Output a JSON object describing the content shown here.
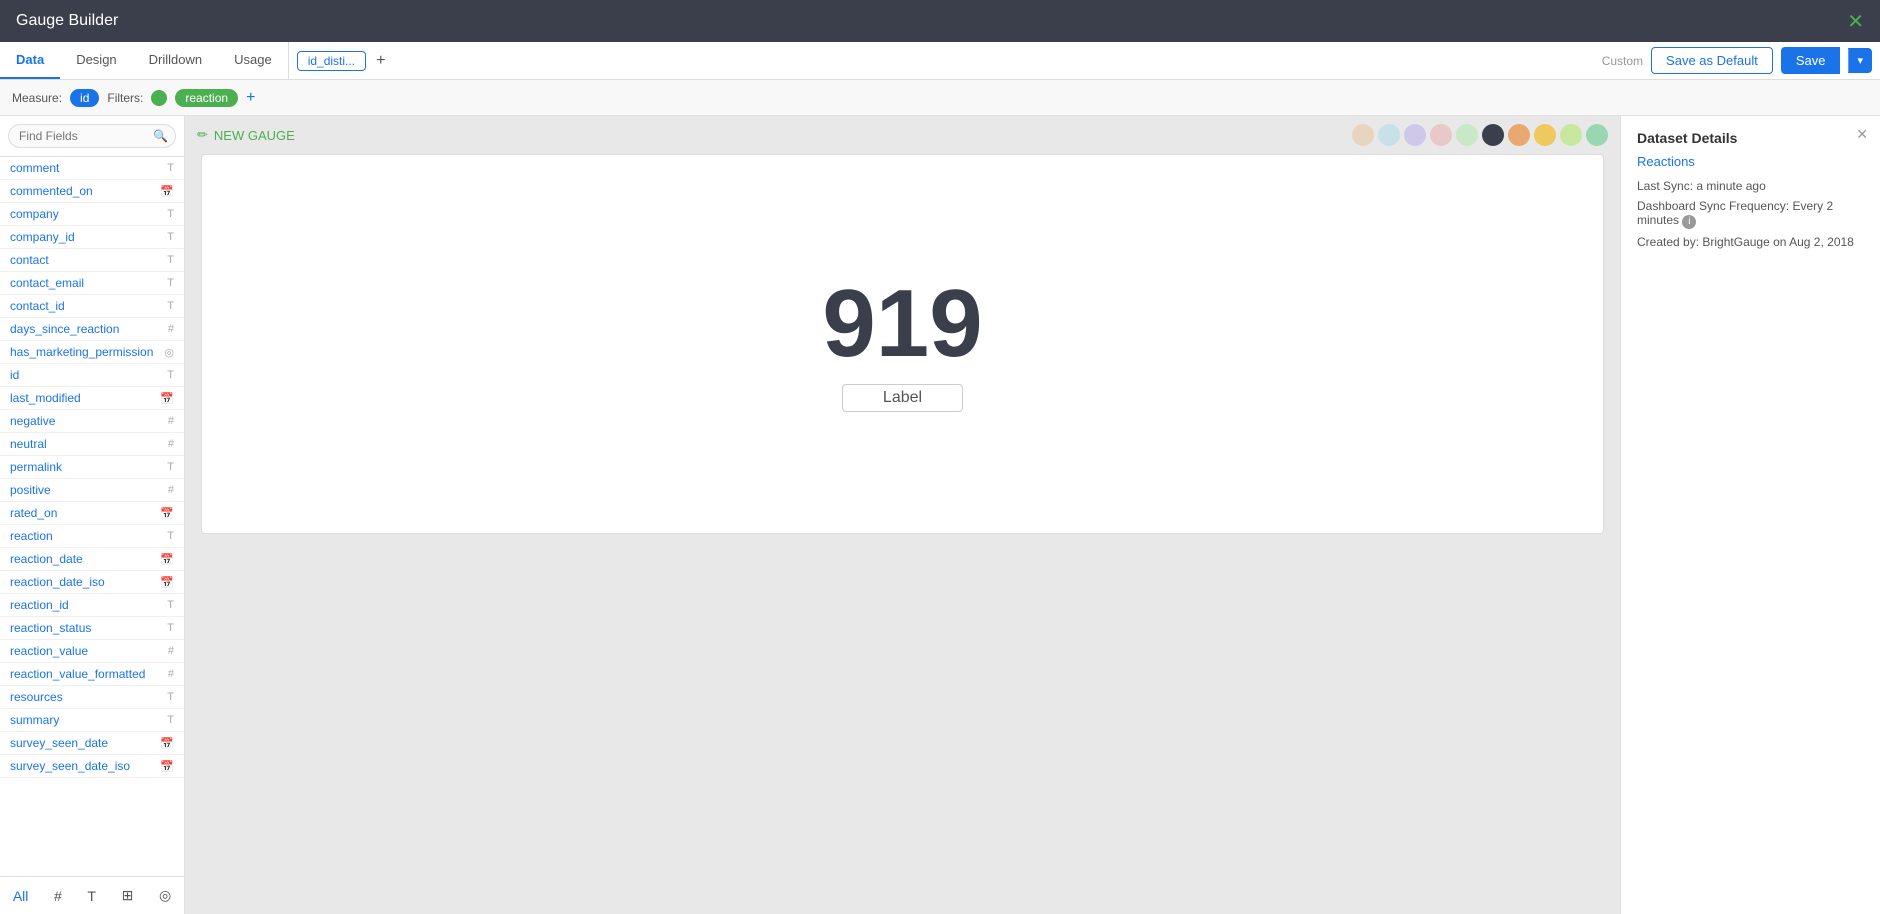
{
  "app": {
    "title": "Gauge Builder",
    "close_icon": "✕"
  },
  "tabs": {
    "items": [
      {
        "id": "data",
        "label": "Data",
        "active": true
      },
      {
        "id": "design",
        "label": "Design",
        "active": false
      },
      {
        "id": "drilldown",
        "label": "Drilldown",
        "active": false
      },
      {
        "id": "usage",
        "label": "Usage",
        "active": false
      }
    ]
  },
  "dataset_tabs": {
    "items": [
      {
        "id": "id_dist",
        "label": "id_disti...",
        "active": true
      }
    ],
    "add_label": "+"
  },
  "toolbar": {
    "custom_label": "Custom",
    "save_default_label": "Save as Default",
    "save_label": "Save",
    "dropdown_icon": "▾"
  },
  "measure_bar": {
    "measure_label": "Measure:",
    "measure_value": "id",
    "filters_label": "Filters:",
    "filter_value": "reaction",
    "add_icon": "+"
  },
  "sidebar": {
    "search_placeholder": "Find Fields",
    "fields": [
      {
        "name": "comment",
        "type": "T"
      },
      {
        "name": "commented_on",
        "type": "cal"
      },
      {
        "name": "company",
        "type": "T"
      },
      {
        "name": "company_id",
        "type": "T"
      },
      {
        "name": "contact",
        "type": "T"
      },
      {
        "name": "contact_email",
        "type": "T"
      },
      {
        "name": "contact_id",
        "type": "T"
      },
      {
        "name": "days_since_reaction",
        "type": "#"
      },
      {
        "name": "has_marketing_permission",
        "type": "eye"
      },
      {
        "name": "id",
        "type": "T"
      },
      {
        "name": "last_modified",
        "type": "cal"
      },
      {
        "name": "negative",
        "type": "#"
      },
      {
        "name": "neutral",
        "type": "#"
      },
      {
        "name": "permalink",
        "type": "T"
      },
      {
        "name": "positive",
        "type": "#"
      },
      {
        "name": "rated_on",
        "type": "cal"
      },
      {
        "name": "reaction",
        "type": "T"
      },
      {
        "name": "reaction_date",
        "type": "cal"
      },
      {
        "name": "reaction_date_iso",
        "type": "cal"
      },
      {
        "name": "reaction_id",
        "type": "T"
      },
      {
        "name": "reaction_status",
        "type": "T"
      },
      {
        "name": "reaction_value",
        "type": "#"
      },
      {
        "name": "reaction_value_formatted",
        "type": "#"
      },
      {
        "name": "resources",
        "type": "T"
      },
      {
        "name": "summary",
        "type": "T"
      },
      {
        "name": "survey_seen_date",
        "type": "cal"
      },
      {
        "name": "survey_seen_date_iso",
        "type": "cal"
      }
    ],
    "footer_filters": [
      {
        "id": "all",
        "label": "All",
        "active": true
      },
      {
        "id": "hash",
        "label": "#"
      },
      {
        "id": "text",
        "label": "T"
      },
      {
        "id": "table",
        "label": "⊞"
      },
      {
        "id": "eye",
        "label": "◎"
      }
    ]
  },
  "gauge": {
    "title": "NEW GAUGE",
    "number": "919",
    "label": "Label",
    "colors": [
      "#e8d5c0",
      "#c8e0e8",
      "#d0c8e8",
      "#e8c8c8",
      "#c8e8c8",
      "#3a3f4b",
      "#e8a870",
      "#f0c860",
      "#c8e8a0",
      "#98d8b0"
    ]
  },
  "details_panel": {
    "title": "Dataset Details",
    "close_icon": "✕",
    "dataset_name": "Reactions",
    "last_sync_label": "Last Sync:",
    "last_sync_value": "a minute ago",
    "sync_freq_label": "Dashboard Sync Frequency:",
    "sync_freq_value": "Every 2 minutes",
    "created_label": "Created by:",
    "created_value": "BrightGauge on Aug 2, 2018"
  }
}
